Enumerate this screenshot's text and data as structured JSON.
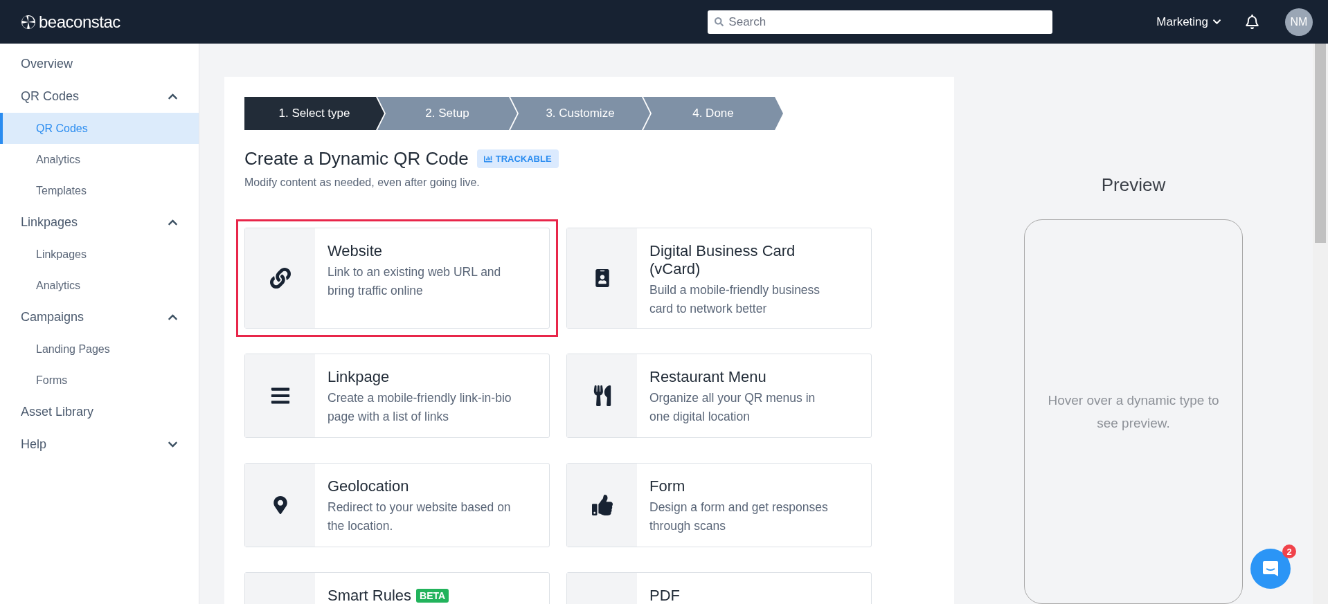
{
  "topbar": {
    "logo": "beaconstac",
    "search": {
      "placeholder": "Search"
    },
    "workspace": "Marketing",
    "avatar": "NM"
  },
  "sidebar": {
    "items": [
      {
        "label": "Overview",
        "kind": "link"
      },
      {
        "label": "QR Codes",
        "kind": "section",
        "expanded": true,
        "children": [
          {
            "label": "QR Codes",
            "selected": true
          },
          {
            "label": "Analytics",
            "selected": false
          },
          {
            "label": "Templates",
            "selected": false
          }
        ]
      },
      {
        "label": "Linkpages",
        "kind": "section",
        "expanded": true,
        "children": [
          {
            "label": "Linkpages",
            "selected": false
          },
          {
            "label": "Analytics",
            "selected": false
          }
        ]
      },
      {
        "label": "Campaigns",
        "kind": "section",
        "expanded": true,
        "children": [
          {
            "label": "Landing Pages",
            "selected": false
          },
          {
            "label": "Forms",
            "selected": false
          }
        ]
      },
      {
        "label": "Asset Library",
        "kind": "link"
      },
      {
        "label": "Help",
        "kind": "section",
        "expanded": false
      }
    ]
  },
  "steps": [
    {
      "label": "1. Select type",
      "selected": true
    },
    {
      "label": "2. Setup",
      "selected": false
    },
    {
      "label": "3. Customize",
      "selected": false
    },
    {
      "label": "4. Done",
      "selected": false
    }
  ],
  "heading": {
    "title": "Create a Dynamic QR Code",
    "badge": "TRACKABLE",
    "subtitle": "Modify content as needed, even after going live."
  },
  "types": [
    {
      "kind": "link",
      "title": "Website",
      "description": "Link to an existing web URL and bring traffic online",
      "selected": true
    },
    {
      "kind": "badge",
      "title": "Digital Business Card (vCard)",
      "description": "Build a mobile-friendly business card to network better",
      "selected": false
    },
    {
      "kind": "list",
      "title": "Linkpage",
      "description": "Create a mobile-friendly link-in-bio page with a list of links",
      "selected": false
    },
    {
      "kind": "menu",
      "title": "Restaurant Menu",
      "description": "Organize all your QR menus in one digital location",
      "selected": false
    },
    {
      "kind": "location",
      "title": "Geolocation",
      "description": "Redirect to your website based on the location.",
      "selected": false
    },
    {
      "kind": "form",
      "title": "Form",
      "description": "Design a form and get responses through scans",
      "selected": false
    },
    {
      "kind": "rules",
      "title": "Smart Rules",
      "badge": "BETA",
      "selected": false
    },
    {
      "kind": "pdf",
      "title": "PDF",
      "selected": false
    }
  ],
  "preview": {
    "title": "Preview",
    "hint": "Hover over a dynamic type to see preview."
  },
  "chat": {
    "count": "2"
  }
}
